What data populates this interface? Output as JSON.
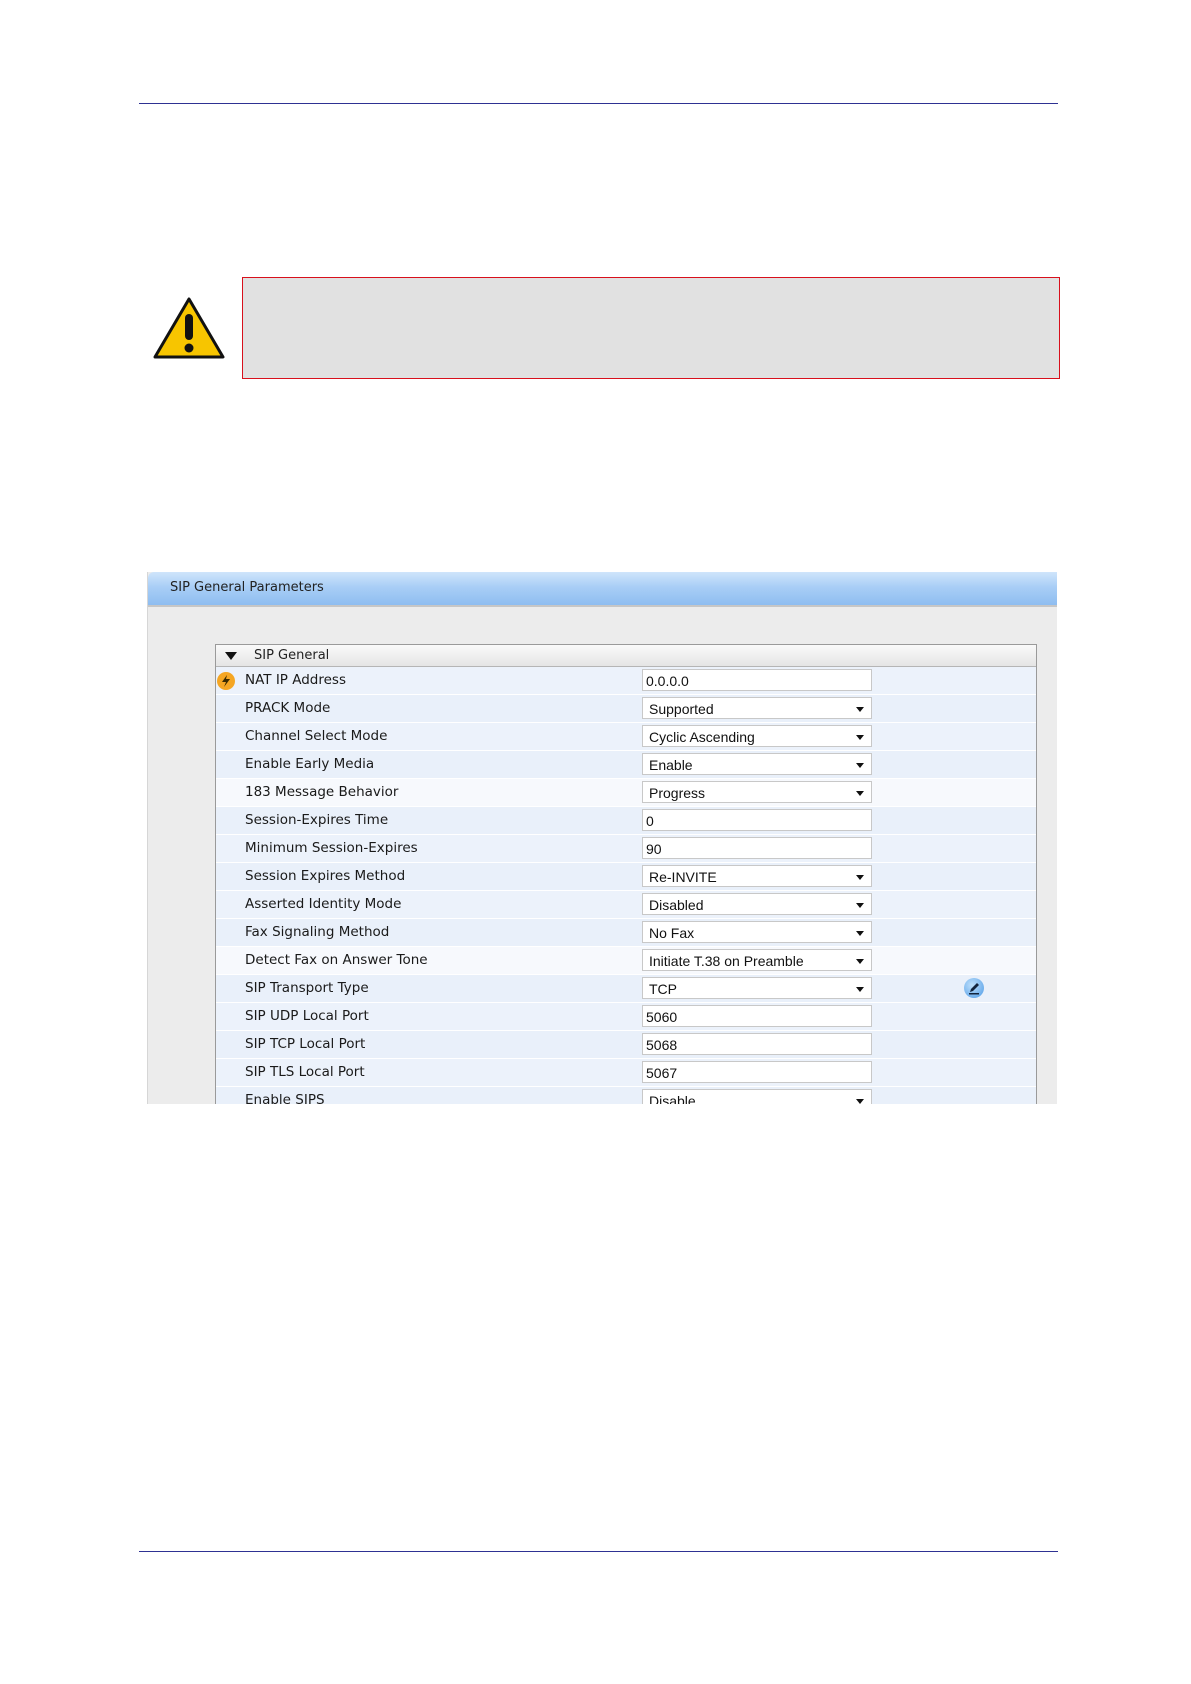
{
  "panel": {
    "title": "SIP General Parameters"
  },
  "section": {
    "title": "SIP General"
  },
  "rows": [
    {
      "label": "NAT IP Address",
      "value": "0.0.0.0",
      "type": "text",
      "icon": "lightning-icon"
    },
    {
      "label": "PRACK Mode",
      "value": "Supported",
      "type": "select"
    },
    {
      "label": "Channel Select Mode",
      "value": "Cyclic Ascending",
      "type": "select"
    },
    {
      "label": "Enable Early Media",
      "value": "Enable",
      "type": "select"
    },
    {
      "label": "183 Message Behavior",
      "value": "Progress",
      "type": "select",
      "highlight": true
    },
    {
      "label": "Session-Expires Time",
      "value": "0",
      "type": "text"
    },
    {
      "label": "Minimum Session-Expires",
      "value": "90",
      "type": "text"
    },
    {
      "label": "Session Expires Method",
      "value": "Re-INVITE",
      "type": "select"
    },
    {
      "label": "Asserted Identity Mode",
      "value": "Disabled",
      "type": "select"
    },
    {
      "label": "Fax Signaling Method",
      "value": "No Fax",
      "type": "select"
    },
    {
      "label": "Detect Fax on Answer Tone",
      "value": "Initiate T.38 on Preamble",
      "type": "select",
      "highlight": true
    },
    {
      "label": "SIP Transport Type",
      "value": "TCP",
      "type": "select",
      "icon": "edit-pencil-icon"
    },
    {
      "label": "SIP UDP Local Port",
      "value": "5060",
      "type": "text"
    },
    {
      "label": "SIP TCP Local Port",
      "value": "5068",
      "type": "text"
    },
    {
      "label": "SIP TLS Local Port",
      "value": "5067",
      "type": "text"
    },
    {
      "label": "Enable SIPS",
      "value": "Disable",
      "type": "select"
    }
  ],
  "icons": {
    "warning": "warning-triangle-icon",
    "collapse": "triangle-down-icon"
  },
  "colors": {
    "rule": "#2e3192",
    "note_border": "#d8101c",
    "note_fill": "#e1e1e1",
    "header_blue": "#a9cef6"
  }
}
